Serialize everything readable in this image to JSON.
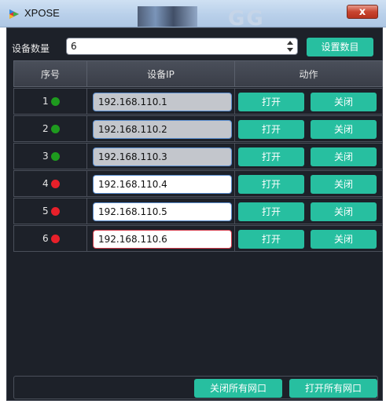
{
  "window": {
    "title": "XPOSE",
    "close_glyph": "x",
    "background_text": "GG"
  },
  "device_count": {
    "label": "设备数量",
    "value": "6",
    "set_button": "设置数目"
  },
  "table": {
    "headers": [
      "序号",
      "设备IP",
      "动作"
    ],
    "rows": [
      {
        "index": "1",
        "status": "online",
        "status_color": "#1e9b1e",
        "ip": "192.168.110.1",
        "field_state": "disabled",
        "open_label": "打开",
        "close_label": "关闭"
      },
      {
        "index": "2",
        "status": "online",
        "status_color": "#1e9b1e",
        "ip": "192.168.110.2",
        "field_state": "disabled",
        "open_label": "打开",
        "close_label": "关闭"
      },
      {
        "index": "3",
        "status": "online",
        "status_color": "#1e9b1e",
        "ip": "192.168.110.3",
        "field_state": "disabled",
        "open_label": "打开",
        "close_label": "关闭"
      },
      {
        "index": "4",
        "status": "offline",
        "status_color": "#e8202a",
        "ip": "192.168.110.4",
        "field_state": "enabled",
        "open_label": "打开",
        "close_label": "关闭"
      },
      {
        "index": "5",
        "status": "offline",
        "status_color": "#e8202a",
        "ip": "192.168.110.5",
        "field_state": "enabled",
        "open_label": "打开",
        "close_label": "关闭"
      },
      {
        "index": "6",
        "status": "offline",
        "status_color": "#e8202a",
        "ip": "192.168.110.6",
        "field_state": "error",
        "open_label": "打开",
        "close_label": "关闭"
      }
    ]
  },
  "footer": {
    "close_all": "关闭所有网口",
    "open_all": "打开所有网口"
  },
  "colors": {
    "accent": "#27bfa0",
    "panel": "#1d2129"
  }
}
